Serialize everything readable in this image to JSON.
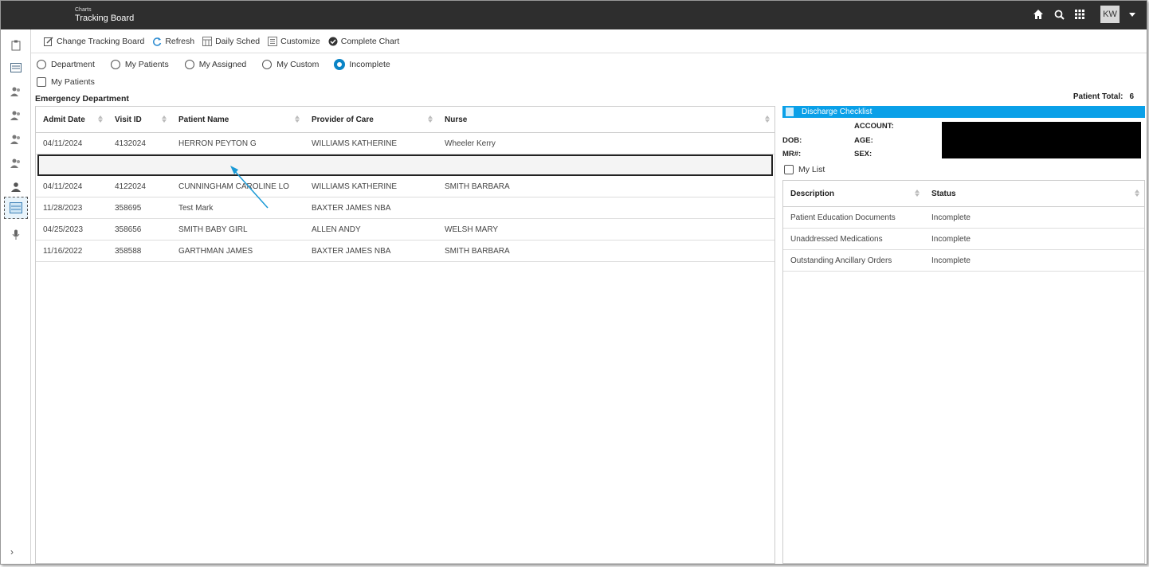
{
  "topbar": {
    "app_small": "Charts",
    "app_title": "Tracking Board",
    "user_initials": "KW"
  },
  "toolbar": {
    "change_board": "Change Tracking Board",
    "refresh": "Refresh",
    "daily_sched": "Daily Sched",
    "customize": "Customize",
    "complete_chart": "Complete Chart"
  },
  "filters": {
    "department": "Department",
    "my_patients_radio": "My Patients",
    "my_assigned": "My Assigned",
    "my_custom": "My Custom",
    "incomplete": "Incomplete",
    "selected": "incomplete",
    "my_patients_checkbox": "My Patients"
  },
  "section": {
    "title": "Emergency Department",
    "patient_total_label": "Patient Total:",
    "patient_total_value": "6"
  },
  "table": {
    "headers": {
      "admit_date": "Admit Date",
      "visit_id": "Visit ID",
      "patient_name": "Patient Name",
      "provider": "Provider of Care",
      "nurse": "Nurse"
    },
    "rows": [
      {
        "admit": "04/11/2024",
        "visit": "4132024",
        "name": "HERRON PEYTON G",
        "provider": "WILLIAMS KATHERINE",
        "nurse": "Wheeler Kerry"
      },
      {
        "admit": "",
        "visit": "",
        "name": "",
        "provider": "",
        "nurse": ""
      },
      {
        "admit": "04/11/2024",
        "visit": "4122024",
        "name": "CUNNINGHAM CAROLINE LO",
        "provider": "WILLIAMS KATHERINE",
        "nurse": "SMITH BARBARA"
      },
      {
        "admit": "11/28/2023",
        "visit": "358695",
        "name": "Test Mark",
        "provider": "BAXTER JAMES NBA",
        "nurse": ""
      },
      {
        "admit": "04/25/2023",
        "visit": "358656",
        "name": "SMITH BABY GIRL",
        "provider": "ALLEN ANDY",
        "nurse": "WELSH MARY"
      },
      {
        "admit": "11/16/2022",
        "visit": "358588",
        "name": "GARTHMAN JAMES",
        "provider": "BAXTER JAMES NBA",
        "nurse": "SMITH BARBARA"
      }
    ]
  },
  "right_panel": {
    "header": "Discharge Checklist",
    "account_label": "ACCOUNT:",
    "dob_label": "DOB:",
    "age_label": "AGE:",
    "mr_label": "MR#:",
    "sex_label": "SEX:",
    "my_list": "My List",
    "headers": {
      "description": "Description",
      "status": "Status"
    },
    "items": [
      {
        "description": "Patient Education Documents",
        "status": "Incomplete"
      },
      {
        "description": "Unaddressed Medications",
        "status": "Incomplete"
      },
      {
        "description": "Outstanding Ancillary Orders",
        "status": "Incomplete"
      }
    ]
  },
  "colors": {
    "topbar": "#2e2e2e",
    "accent": "#0aa0e8",
    "radio_selected": "#0a84c6"
  }
}
